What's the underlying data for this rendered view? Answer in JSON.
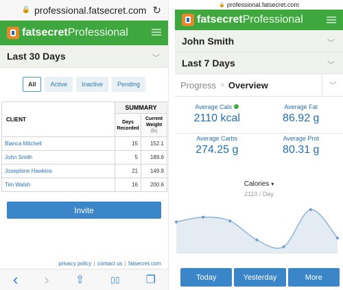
{
  "left": {
    "url": "professional.fatsecret.com",
    "brand": {
      "strong": "fatsecret",
      "light": "Professional"
    },
    "period": "Last 30 Days",
    "filters": [
      "All",
      "Active",
      "Inactive",
      "Pending"
    ],
    "active_filter": "All",
    "table": {
      "col_client": "CLIENT",
      "col_summary": "SUMMARY",
      "col_days": "Days Recorded",
      "col_weight": "Current Weight",
      "col_weight_unit": "(lb)",
      "rows": [
        {
          "name": "Bianca Mitchell",
          "days": "15",
          "weight": "152.1"
        },
        {
          "name": "John Smith",
          "days": "5",
          "weight": "189.6"
        },
        {
          "name": "Josephine Hawkins",
          "days": "21",
          "weight": "149.9"
        },
        {
          "name": "Tim Walsh",
          "days": "16",
          "weight": "200.6"
        }
      ]
    },
    "invite_label": "Invite",
    "footer": {
      "privacy": "privacy policy",
      "contact": "contact us",
      "site": "fatsecret.com",
      "sep": "|"
    },
    "toolbar": {
      "back": "‹",
      "forward": "›",
      "share": "⇧",
      "bookmarks": "▯▯",
      "tabs": "❐"
    }
  },
  "right": {
    "url": "professional.fatsecret.com",
    "brand": {
      "strong": "fatsecret",
      "light": "Professional"
    },
    "client": "John Smith",
    "period": "Last 7 Days",
    "breadcrumb": {
      "parent": "Progress",
      "sep": ">",
      "current": "Overview"
    },
    "stats": [
      {
        "label": "Average Cals",
        "value": "2110 kcal"
      },
      {
        "label": "Average Fat",
        "value": "86.92 g"
      },
      {
        "label": "Average Carbs",
        "value": "274.25 g"
      },
      {
        "label": "Average Prot",
        "value": "80.31 g"
      }
    ],
    "calories": {
      "title": "Calories",
      "caret": "▾",
      "subtitle": "2110 / Day"
    },
    "buttons": [
      "Today",
      "Yesterday",
      "More"
    ]
  },
  "colors": {
    "brand_green": "#3ea83e",
    "accent_blue": "#3a86c8",
    "status_green": "#3dad44"
  },
  "chart_data": {
    "type": "area",
    "x": [
      1,
      2,
      3,
      4,
      5,
      6,
      7
    ],
    "values": [
      2120,
      2170,
      2130,
      1930,
      1860,
      2250,
      1950
    ],
    "ylim": [
      1800,
      2320
    ]
  }
}
